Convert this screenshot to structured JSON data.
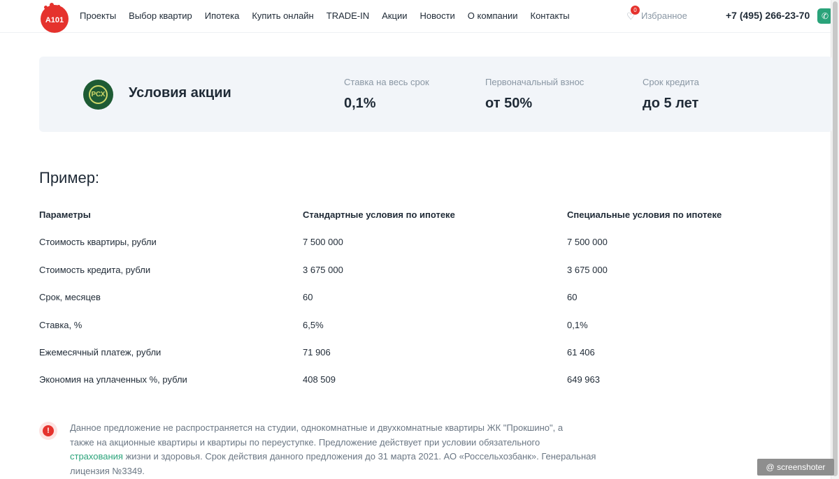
{
  "header": {
    "logo_text": "A101",
    "nav": [
      "Проекты",
      "Выбор квартир",
      "Ипотека",
      "Купить онлайн",
      "TRADE-IN",
      "Акции",
      "Новости",
      "О компании",
      "Контакты"
    ],
    "favorites_count": "0",
    "favorites_label": "Избранное",
    "phone": "+7 (495) 266-23-70"
  },
  "promo": {
    "title": "Условия акции",
    "stats": [
      {
        "label": "Ставка на весь срок",
        "value": "0,1%"
      },
      {
        "label": "Первоначальный взнос",
        "value": "от 50%"
      },
      {
        "label": "Срок кредита",
        "value": "до 5 лет"
      }
    ]
  },
  "example": {
    "title": "Пример:",
    "headers": [
      "Параметры",
      "Стандартные условия по ипотеке",
      "Специальные условия по ипотеке"
    ],
    "rows": [
      [
        "Стоимость квартиры, рубли",
        "7 500 000",
        "7 500 000"
      ],
      [
        "Стоимость кредита, рубли",
        "3 675 000",
        "3 675 000"
      ],
      [
        "Срок, месяцев",
        "60",
        "60"
      ],
      [
        "Ставка, %",
        "6,5%",
        "0,1%"
      ],
      [
        "Ежемесячный платеж, рубли",
        "71 906",
        "61 406"
      ],
      [
        "Экономия на уплаченных %, рубли",
        "408 509",
        "649 963"
      ]
    ]
  },
  "notice": {
    "line1": "Данное предложение не распространяется на студии, однокомнатные и двухкомнатные квартиры ЖК \"Прокшино\", а",
    "line2": "также на акционные квартиры и квартиры по переуступке. Предложение действует при условии обязательного",
    "link": "страхования",
    "line3_rest": " жизни и здоровья. Срок действия данного предложения до 31 марта 2021. АО «Россельхозбанк». Генеральная",
    "line4": "лицензия №3349."
  },
  "watermark": "@ screenshoter",
  "colors": {
    "brand_red": "#e5322d",
    "accent_green": "#2aa37a",
    "panel_bg": "#f2f5f9"
  }
}
